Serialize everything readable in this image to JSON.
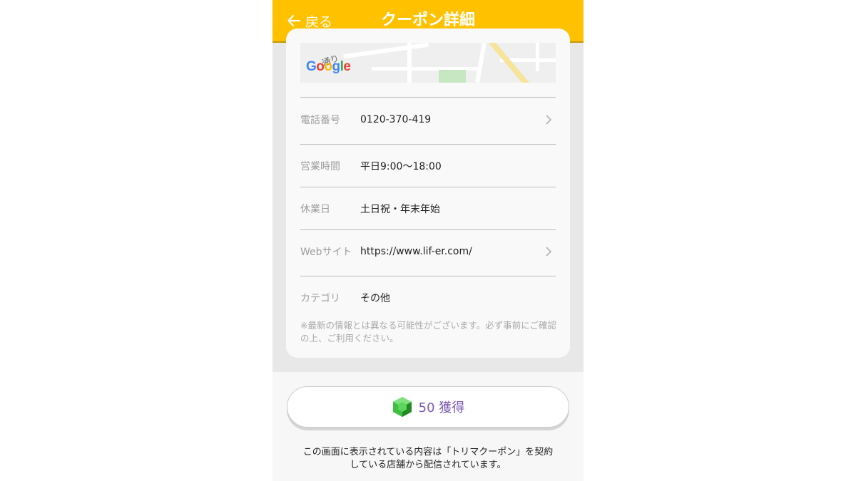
{
  "header": {
    "back_label": "戻る",
    "title": "クーポン詳細"
  },
  "colors": {
    "header_bg": "#ffc100",
    "button_text": "#7b58b4",
    "gem": "#3fbf3f"
  },
  "map": {
    "street_label": "通り",
    "logo": [
      "G",
      "o",
      "o",
      "g",
      "l",
      "e"
    ]
  },
  "details": [
    {
      "label": "電話番号",
      "value": "0120-370-419",
      "link": true
    },
    {
      "label": "営業時間",
      "value": "平日9:00〜18:00",
      "link": false
    },
    {
      "label": "休業日",
      "value": "土日祝・年末年始",
      "link": false
    },
    {
      "label": "Webサイト",
      "value": "https://www.lif-er.com/",
      "link": true
    },
    {
      "label": "カテゴリ",
      "value": "その他",
      "link": false
    }
  ],
  "note": "※最新の情報とは異なる可能性がございます。必ず事前にご確認の上、ご利用ください。",
  "action": {
    "icon": "green-gem-icon",
    "label": "50 獲得"
  },
  "footer": {
    "line1": "この画面に表示されている内容は「トリマクーポン」を契約",
    "line2": "している店舗から配信されています。"
  }
}
